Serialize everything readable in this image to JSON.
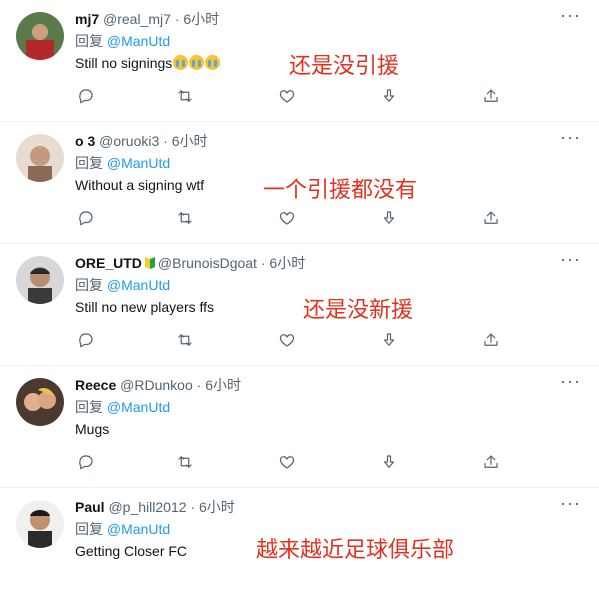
{
  "tweets": [
    {
      "name": "mj7",
      "handle": "@real_mj7",
      "time": "6小时",
      "reply_prefix": "回复",
      "reply_to": "@ManUtd",
      "text": "Still no signings",
      "emoji_count": 3,
      "overlay": "还是没引援",
      "avatar_bg": "#8b2c2c"
    },
    {
      "name": "o 3",
      "handle": "@oruoki3",
      "time": "6小时",
      "reply_prefix": "回复",
      "reply_to": "@ManUtd",
      "text": "Without a signing wtf",
      "overlay": "一个引援都没有",
      "avatar_bg": "#caa890"
    },
    {
      "name": "ORE_UTD",
      "handle": "@BrunoisDgoat",
      "time": "6小时",
      "reply_prefix": "回复",
      "reply_to": "@ManUtd",
      "text": "Still no new players ffs",
      "overlay": "还是没新援",
      "avatar_bg": "#bfbfbf"
    },
    {
      "name": "Reece",
      "handle": "@RDunkoo",
      "time": "6小时",
      "reply_prefix": "回复",
      "reply_to": "@ManUtd",
      "text": "Mugs",
      "overlay": "",
      "avatar_bg": "#6a4a3a"
    },
    {
      "name": "Paul",
      "handle": "@p_hill2012",
      "time": "6小时",
      "reply_prefix": "回复",
      "reply_to": "@ManUtd",
      "text": "Getting Closer FC",
      "overlay": "越来越近足球俱乐部",
      "avatar_bg": "#3c3c3c"
    }
  ],
  "dot": "·",
  "more_label": "···",
  "colors": {
    "accent": "#1d9bf0",
    "secondary": "#536471",
    "overlay": "#e0321e"
  },
  "icons": [
    "reply-icon",
    "retweet-icon",
    "like-icon",
    "download-icon",
    "share-icon"
  ]
}
